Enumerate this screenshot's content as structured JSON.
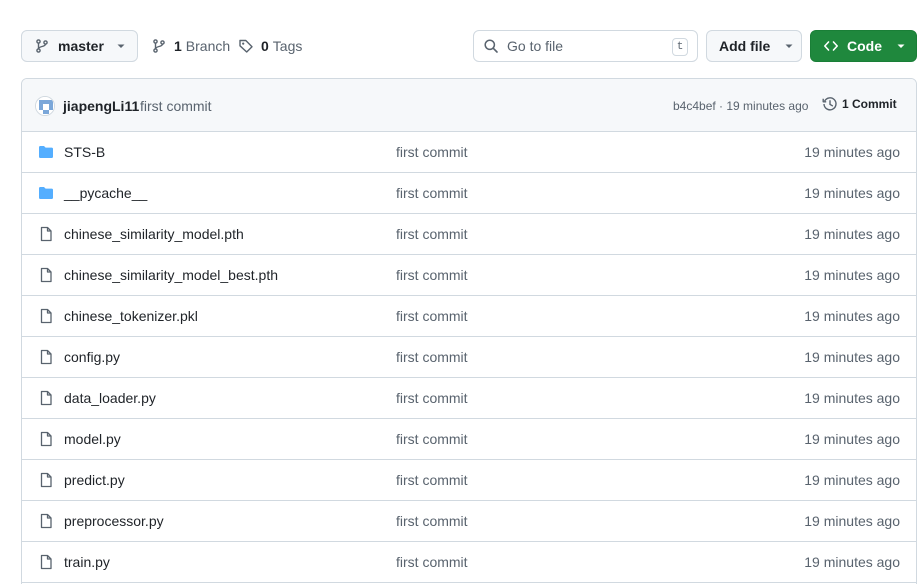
{
  "toolbar": {
    "branch": "master",
    "branches_count": "1",
    "branches_label": "Branch",
    "tags_count": "0",
    "tags_label": "Tags",
    "search_placeholder": "Go to file",
    "search_shortcut": "t",
    "add_file_label": "Add file",
    "code_label": "Code"
  },
  "commit": {
    "author": "jiapengLi11",
    "message": "first commit",
    "meta": "b4c4bef · 19 minutes ago",
    "count_label": "1 Commit"
  },
  "files": [
    {
      "name": "STS-B",
      "type": "folder",
      "message": "first commit",
      "age": "19 minutes ago"
    },
    {
      "name": "__pycache__",
      "type": "folder",
      "message": "first commit",
      "age": "19 minutes ago"
    },
    {
      "name": "chinese_similarity_model.pth",
      "type": "file",
      "message": "first commit",
      "age": "19 minutes ago"
    },
    {
      "name": "chinese_similarity_model_best.pth",
      "type": "file",
      "message": "first commit",
      "age": "19 minutes ago"
    },
    {
      "name": "chinese_tokenizer.pkl",
      "type": "file",
      "message": "first commit",
      "age": "19 minutes ago"
    },
    {
      "name": "config.py",
      "type": "file",
      "message": "first commit",
      "age": "19 minutes ago"
    },
    {
      "name": "data_loader.py",
      "type": "file",
      "message": "first commit",
      "age": "19 minutes ago"
    },
    {
      "name": "model.py",
      "type": "file",
      "message": "first commit",
      "age": "19 minutes ago"
    },
    {
      "name": "predict.py",
      "type": "file",
      "message": "first commit",
      "age": "19 minutes ago"
    },
    {
      "name": "preprocessor.py",
      "type": "file",
      "message": "first commit",
      "age": "19 minutes ago"
    },
    {
      "name": "train.py",
      "type": "file",
      "message": "first commit",
      "age": "19 minutes ago"
    }
  ],
  "colors": {
    "accent_green": "#1f883d",
    "folder_blue": "#54aeff",
    "muted_text": "#59636e",
    "border": "#d1d9e0"
  },
  "icons": {
    "branch": "git-branch-icon",
    "tag": "tag-icon",
    "search": "search-icon",
    "code": "code-icon",
    "history": "history-icon",
    "folder": "folder-icon",
    "file": "file-icon"
  }
}
